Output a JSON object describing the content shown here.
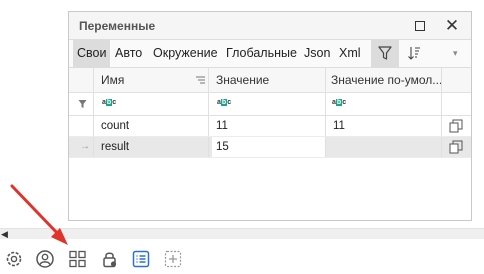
{
  "panel": {
    "title": "Переменные",
    "maximize_icon": "maximize-icon",
    "close_icon": "close-icon",
    "close_glyph": "✕"
  },
  "tabs": [
    {
      "label": "Свои",
      "active": true
    },
    {
      "label": "Авто"
    },
    {
      "label": "Окружение"
    },
    {
      "label": "Глобальные"
    },
    {
      "label": "Json"
    },
    {
      "label": "Xml"
    }
  ],
  "tools": {
    "filter_icon": "filter-icon",
    "sort_icon": "sort-icon",
    "dropdown_glyph": "▾"
  },
  "columns": {
    "name": "Имя",
    "value": "Значение",
    "default_value": "Значение по-умол..."
  },
  "filter": {
    "abc_a": "a",
    "abc_b": "b",
    "abc_c": "c"
  },
  "rows": [
    {
      "name": "count",
      "value": "11",
      "default_value": "11",
      "selected": false
    },
    {
      "name": "result",
      "value": "15",
      "default_value": "",
      "selected": true,
      "indicator": "→"
    }
  ],
  "bottom_toolbar": [
    {
      "icon": "gear-icon"
    },
    {
      "icon": "user-circle-icon"
    },
    {
      "icon": "grid-icon"
    },
    {
      "icon": "lock-icon"
    },
    {
      "icon": "list-icon",
      "active": true
    },
    {
      "icon": "add-box-icon"
    }
  ],
  "splitter": {
    "arrow": "◀"
  },
  "colors": {
    "accent_blue": "#2d6fd6",
    "annotation_red": "#e0332b",
    "abc_green": "#1aa58d"
  }
}
